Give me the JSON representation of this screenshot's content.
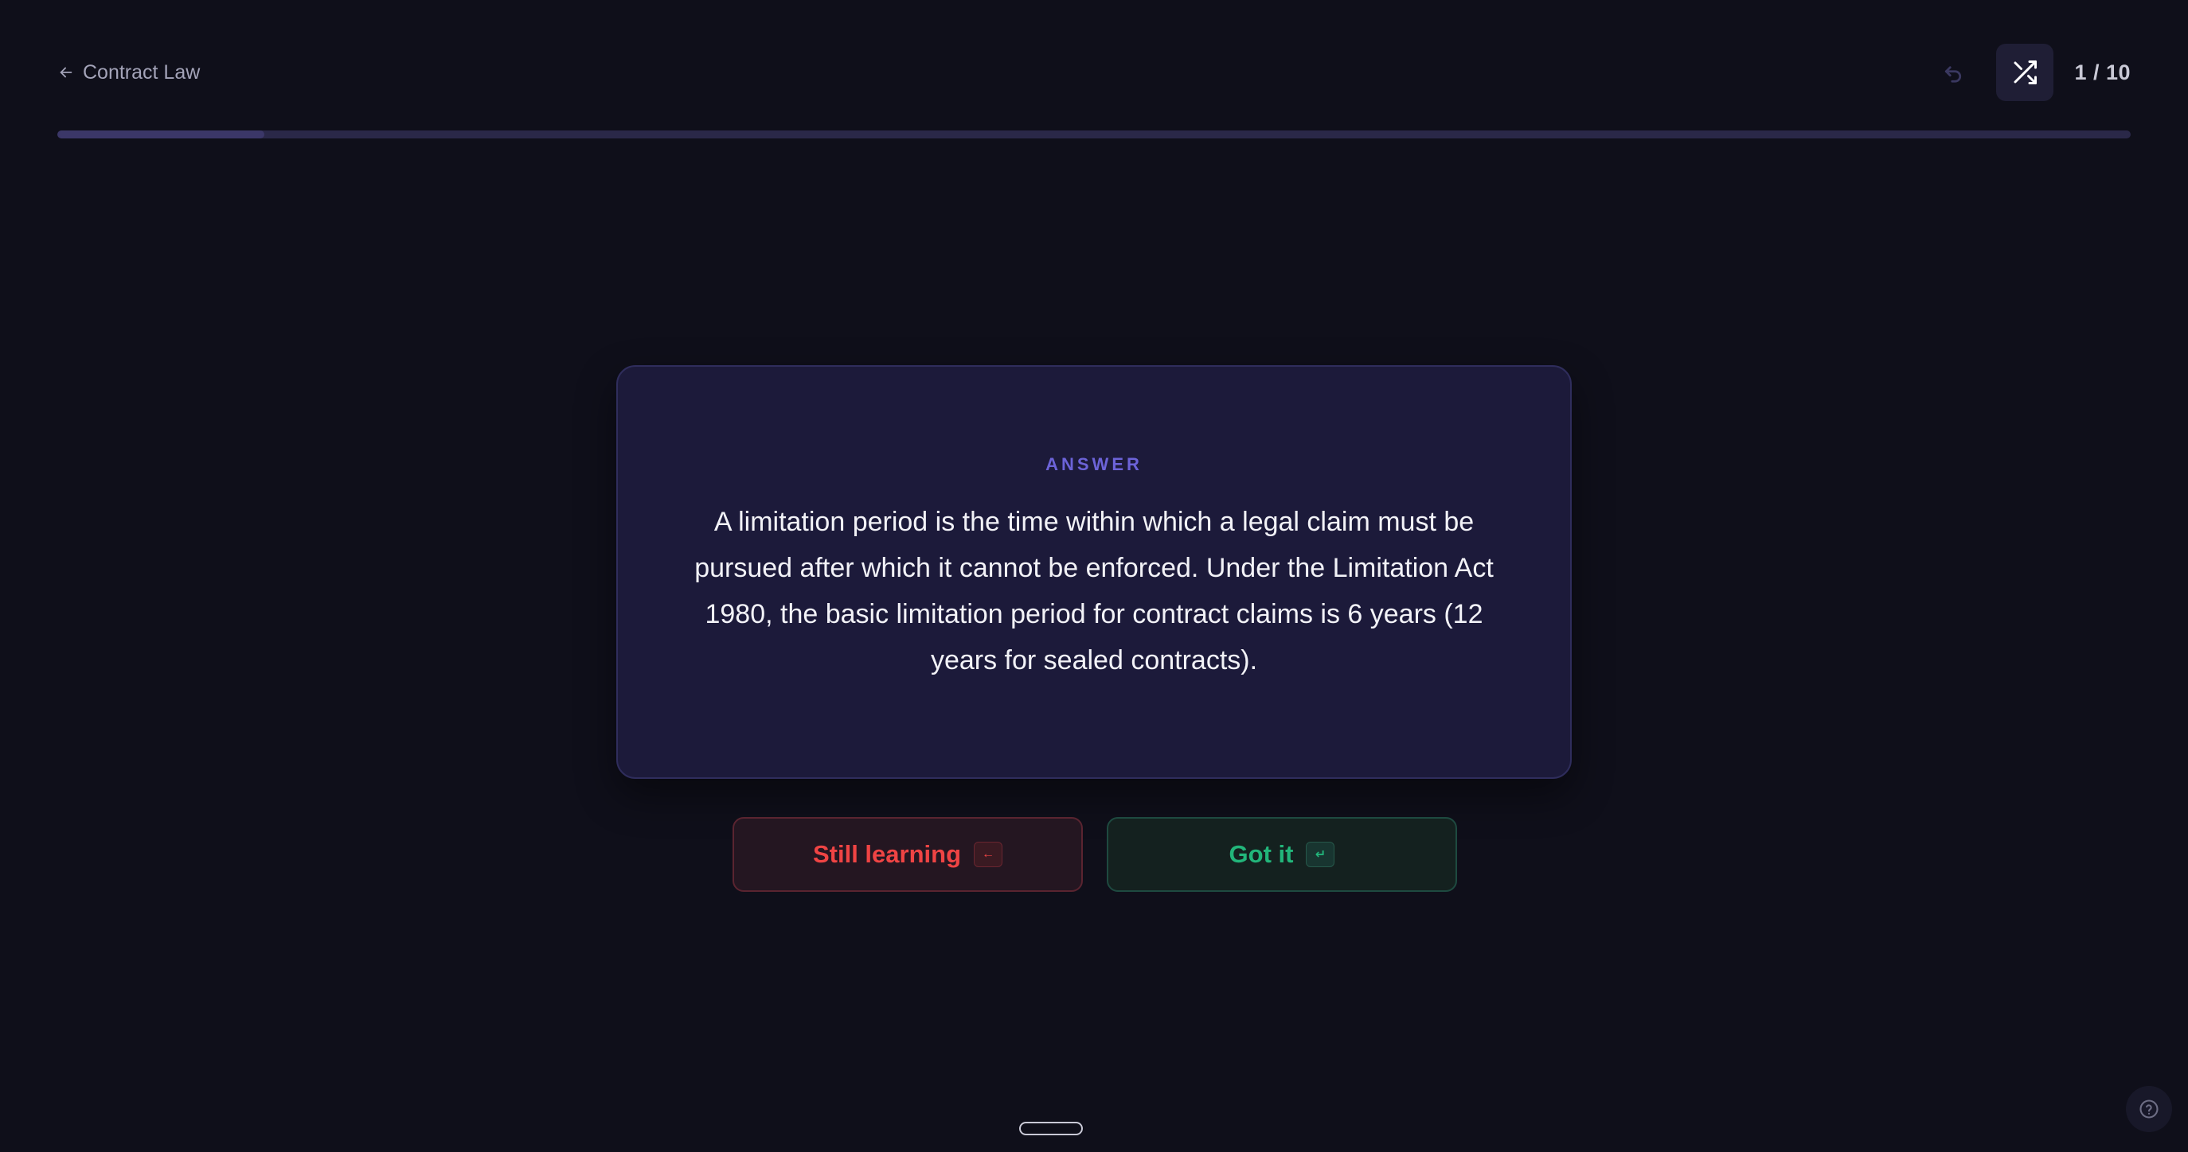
{
  "header": {
    "back_label": "Contract Law",
    "counter": "1 / 10"
  },
  "icons": {
    "back": "arrow-left-icon",
    "undo": "undo-icon",
    "shuffle": "shuffle-icon",
    "help": "help-circle-icon"
  },
  "progress": {
    "fraction": 0.1
  },
  "card": {
    "label": "ANSWER",
    "text": "A limitation period is the time within which a legal claim must be pursued after which it cannot be enforced. Under the Limitation Act 1980, the basic limitation period for contract claims is 6 years (12 years for sealed contracts)."
  },
  "actions": {
    "still_learning": "Still learning",
    "still_learning_key": "←",
    "got_it": "Got it",
    "got_it_key": "↵"
  },
  "colors": {
    "background": "#0f0f1a",
    "card": "#1c1a3a",
    "accent": "#6c63d8",
    "still_learning": "#ef4444",
    "got_it": "#22b57a"
  }
}
